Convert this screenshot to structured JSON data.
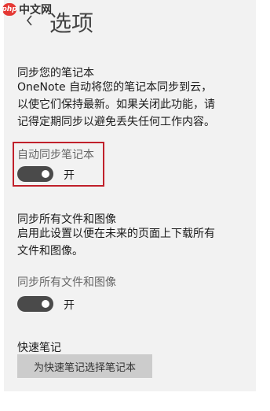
{
  "watermark": {
    "badge": "php",
    "text": "中文网"
  },
  "header": {
    "title": "选项"
  },
  "sync_notebooks": {
    "heading": "同步您的笔记本",
    "description_lines": [
      "OneNote 自动将您的笔记本同步到云，",
      "以使它们保持最新。如果关闭此功能，请",
      "记得定期同步以避免丢失任何工作内容。"
    ],
    "toggle_label": "自动同步笔记本",
    "toggle_on": true,
    "state_text": "开"
  },
  "sync_files": {
    "heading": "同步所有文件和图像",
    "description_lines": [
      "启用此设置以便在未来的页面上下载所有",
      "文件和图像。"
    ],
    "toggle_label": "同步所有文件和图像",
    "toggle_on": true,
    "state_text": "开"
  },
  "quick_notes": {
    "heading": "快速笔记",
    "button_label": "为快速笔记选择笔记本"
  },
  "colors": {
    "panel_bg": "#f2f2f2",
    "toggle_on": "#4a4a4a",
    "highlight_border": "#c0202b",
    "button_bg": "#cccccc"
  }
}
